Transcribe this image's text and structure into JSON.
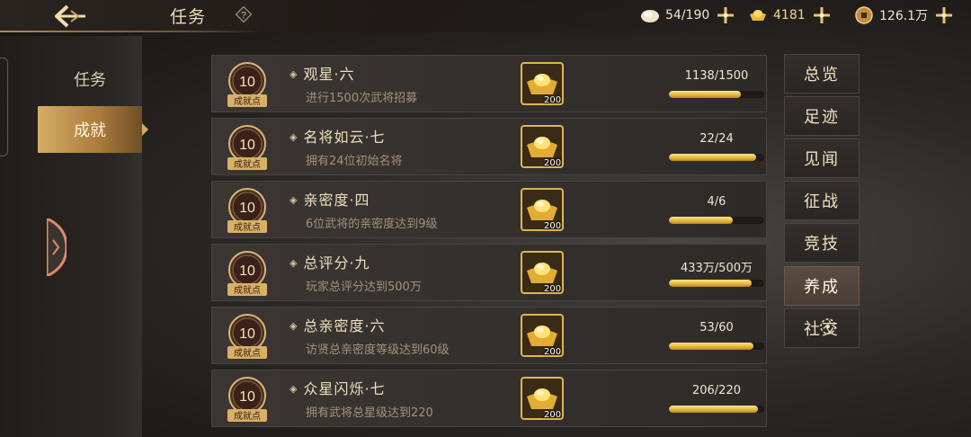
{
  "header": {
    "title": "任务",
    "resources": [
      {
        "icon": "egg-icon",
        "value": "54/190"
      },
      {
        "icon": "gold-ingot-icon",
        "value": "4181"
      },
      {
        "icon": "coin-icon",
        "value": "126.1万"
      }
    ]
  },
  "left_nav": {
    "items": [
      {
        "label": "任务",
        "active": false
      },
      {
        "label": "成就",
        "active": true
      }
    ]
  },
  "achievements": [
    {
      "points": "10",
      "points_label": "成就点",
      "title": "观星·六",
      "desc": "进行1500次武将招募",
      "reward_count": "200",
      "progress_text": "1138/1500",
      "progress": 0.759
    },
    {
      "points": "10",
      "points_label": "成就点",
      "title": "名将如云·七",
      "desc": "拥有24位初始名将",
      "reward_count": "200",
      "progress_text": "22/24",
      "progress": 0.917
    },
    {
      "points": "10",
      "points_label": "成就点",
      "title": "亲密度·四",
      "desc": "6位武将的亲密度达到9级",
      "reward_count": "200",
      "progress_text": "4/6",
      "progress": 0.667
    },
    {
      "points": "10",
      "points_label": "成就点",
      "title": "总评分·九",
      "desc": "玩家总评分达到500万",
      "reward_count": "200",
      "progress_text": "433万/500万",
      "progress": 0.866
    },
    {
      "points": "10",
      "points_label": "成就点",
      "title": "总亲密度·六",
      "desc": "访贤总亲密度等级达到60级",
      "reward_count": "200",
      "progress_text": "53/60",
      "progress": 0.883
    },
    {
      "points": "10",
      "points_label": "成就点",
      "title": "众星闪烁·七",
      "desc": "拥有武将总星级达到220",
      "reward_count": "200",
      "progress_text": "206/220",
      "progress": 0.936
    }
  ],
  "right_tabs": [
    {
      "label": "总览",
      "active": false
    },
    {
      "label": "足迹",
      "active": false
    },
    {
      "label": "见闻",
      "active": false
    },
    {
      "label": "征战",
      "active": false
    },
    {
      "label": "竞技",
      "active": false
    },
    {
      "label": "养成",
      "active": true
    },
    {
      "label": "社交",
      "active": false
    }
  ],
  "colors": {
    "accent_gold": "#e2b43d",
    "active_nav": "#c99b54"
  }
}
